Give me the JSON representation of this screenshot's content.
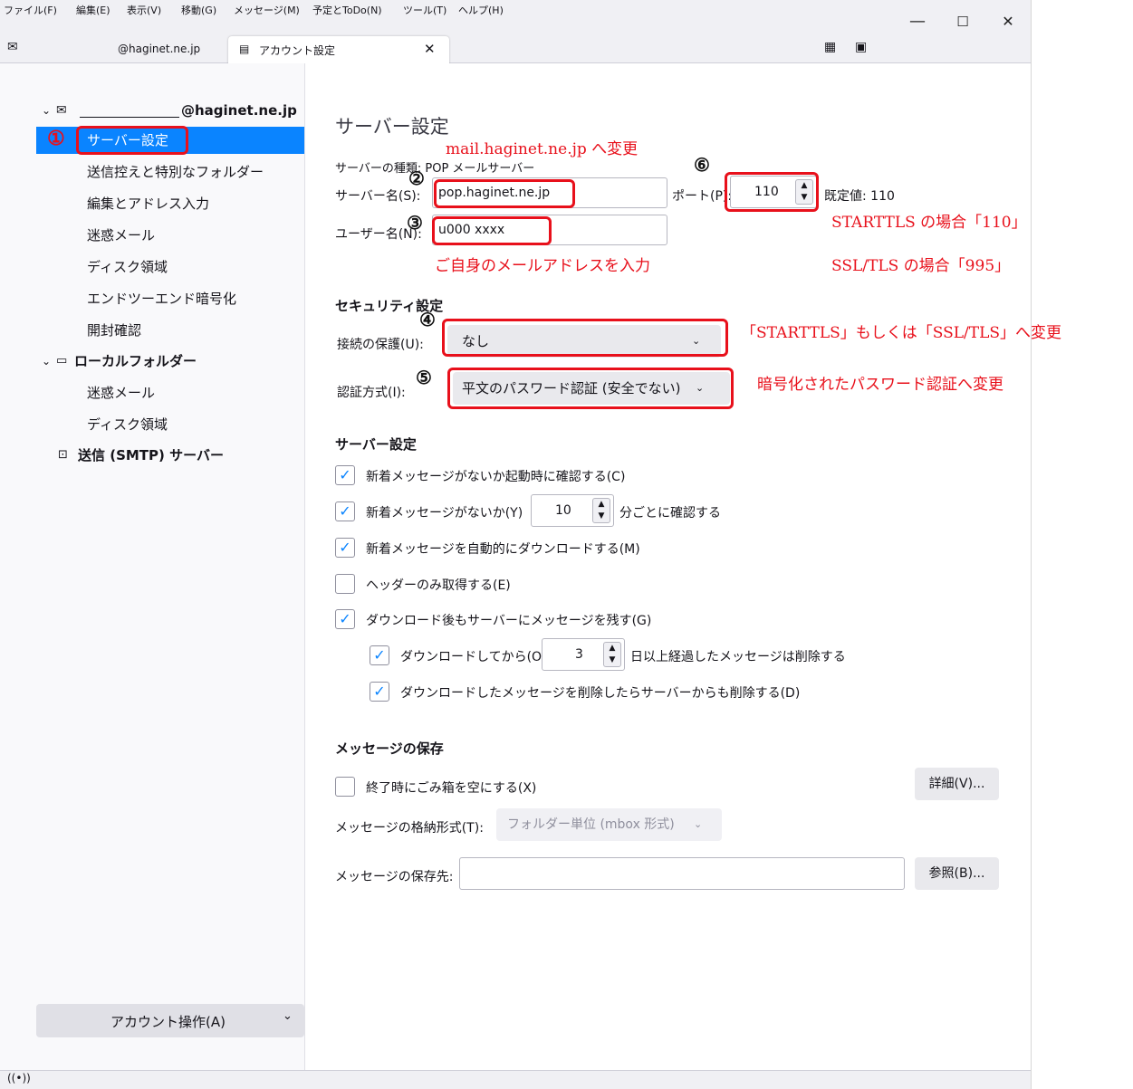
{
  "menu": [
    "ファイル(F)",
    "編集(E)",
    "表示(V)",
    "移動(G)",
    "メッセージ(M)",
    "予定とToDo(N)",
    "ツール(T)",
    "ヘルプ(H)"
  ],
  "tabs": {
    "mail_tab": "@haginet.ne.jp",
    "active_tab": "アカウント設定",
    "close_glyph": "✕"
  },
  "window_controls": {
    "minimize": "—",
    "maximize": "☐",
    "close": "✕"
  },
  "sidebar": {
    "account_name": "@haginet.ne.jp",
    "items": [
      "サーバー設定",
      "送信控えと特別なフォルダー",
      "編集とアドレス入力",
      "迷惑メール",
      "ディスク領域",
      "エンドツーエンド暗号化",
      "開封確認"
    ],
    "local_folders": "ローカルフォルダー",
    "local_items": [
      "迷惑メール",
      "ディスク領域"
    ],
    "smtp": "送信 (SMTP) サーバー",
    "account_actions": "アカウント操作(A)"
  },
  "main": {
    "page_title": "サーバー設定",
    "server_type": "サーバーの種類: POP メールサーバー",
    "server_name_label": "サーバー名(S):",
    "server_name_value": "pop.haginet.ne.jp",
    "port_label": "ポート(P):",
    "port_value": "110",
    "default_port": "既定値: 110",
    "username_label": "ユーザー名(N):",
    "username_value": "u000 xxxx",
    "security_heading": "セキュリティ設定",
    "connection_label": "接続の保護(U):",
    "connection_value": "なし",
    "auth_label": "認証方式(I):",
    "auth_value": "平文のパスワード認証 (安全でない)",
    "server_settings_heading": "サーバー設定",
    "check_startup": "新着メッセージがないか起動時に確認する(C)",
    "check_every_pre": "新着メッセージがないか(Y)",
    "check_every_value": "10",
    "check_every_post": "分ごとに確認する",
    "auto_download": "新着メッセージを自動的にダウンロードする(M)",
    "headers_only": "ヘッダーのみ取得する(E)",
    "leave_on_server": "ダウンロード後もサーバーにメッセージを残す(G)",
    "delete_after_pre": "ダウンロードしてから(O)",
    "delete_after_value": "3",
    "delete_after_post": "日以上経過したメッセージは削除する",
    "delete_from_server": "ダウンロードしたメッセージを削除したらサーバーからも削除する(D)",
    "storage_heading": "メッセージの保存",
    "empty_trash": "終了時にごみ箱を空にする(X)",
    "details_button": "詳細(V)...",
    "storage_format_label": "メッセージの格納形式(T):",
    "storage_format_value": "フォルダー単位 (mbox 形式)",
    "storage_location_label": "メッセージの保存先:",
    "storage_location_value": "",
    "browse_button": "参照(B)..."
  },
  "annotations": {
    "n1": "①",
    "n2": "②",
    "n3": "③",
    "n4": "④",
    "n5": "⑤",
    "n6": "⑥",
    "server_change": "mail.haginet.ne.jp へ変更",
    "username_note": "ご自身のメールアドレスを入力",
    "starttls_port": "STARTTLS の場合「110」",
    "ssl_port": "SSL/TLS の場合「995」",
    "connection_change": "「STARTTLS」もしくは「SSL/TLS」へ変更",
    "auth_change": "暗号化されたパスワード認証へ変更"
  },
  "colors": {
    "accent": "#0a84ff",
    "annotation_red": "#e8101b"
  }
}
